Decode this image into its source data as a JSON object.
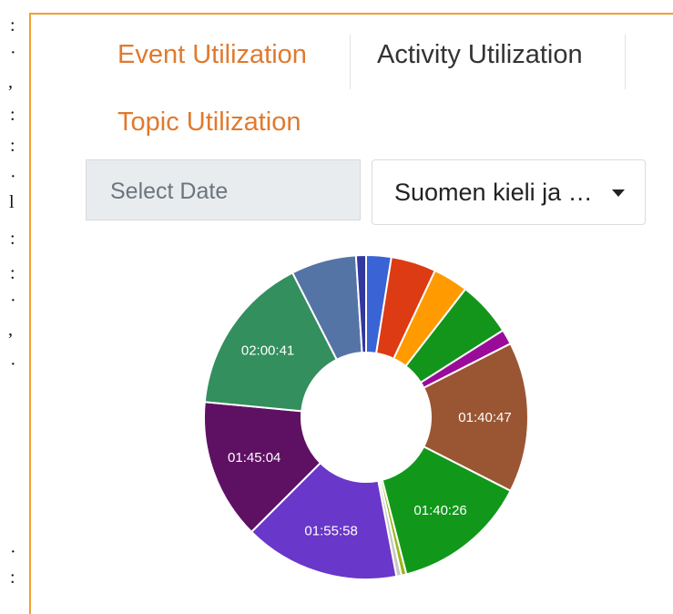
{
  "tabs": [
    {
      "label": "Event Utilization",
      "active": true
    },
    {
      "label": "Activity Utilization",
      "active": false
    },
    {
      "label": "Topic Utilization",
      "active": false
    }
  ],
  "filters": {
    "date_placeholder": "Select Date",
    "selected_topic": "Suomen kieli ja …"
  },
  "colors": {
    "accent": "#e07a2e",
    "panel_border": "#f0a030"
  },
  "chart_data": {
    "type": "pie",
    "title": "",
    "donut": true,
    "slices": [
      {
        "value": 2.5,
        "color": "#3a63d6",
        "label": ""
      },
      {
        "value": 4.5,
        "color": "#dc3b14",
        "label": ""
      },
      {
        "value": 3.5,
        "color": "#ff9a00",
        "label": ""
      },
      {
        "value": 5.5,
        "color": "#13951b",
        "label": ""
      },
      {
        "value": 1.5,
        "color": "#9a0b9a",
        "label": ""
      },
      {
        "value": 15.0,
        "color": "#9a5633",
        "label": "01:40:47"
      },
      {
        "value": 13.5,
        "color": "#11981a",
        "label": "01:40:26"
      },
      {
        "value": 0.5,
        "color": "#9ab716",
        "label": ""
      },
      {
        "value": 0.5,
        "color": "#c8c8c8",
        "label": ""
      },
      {
        "value": 15.5,
        "color": "#6937c9",
        "label": "01:55:58"
      },
      {
        "value": 14.0,
        "color": "#5e1163",
        "label": "01:45:04"
      },
      {
        "value": 16.0,
        "color": "#338f5e",
        "label": "02:00:41"
      },
      {
        "value": 6.5,
        "color": "#5574a6",
        "label": ""
      },
      {
        "value": 1.0,
        "color": "#3337a0",
        "label": ""
      }
    ]
  }
}
